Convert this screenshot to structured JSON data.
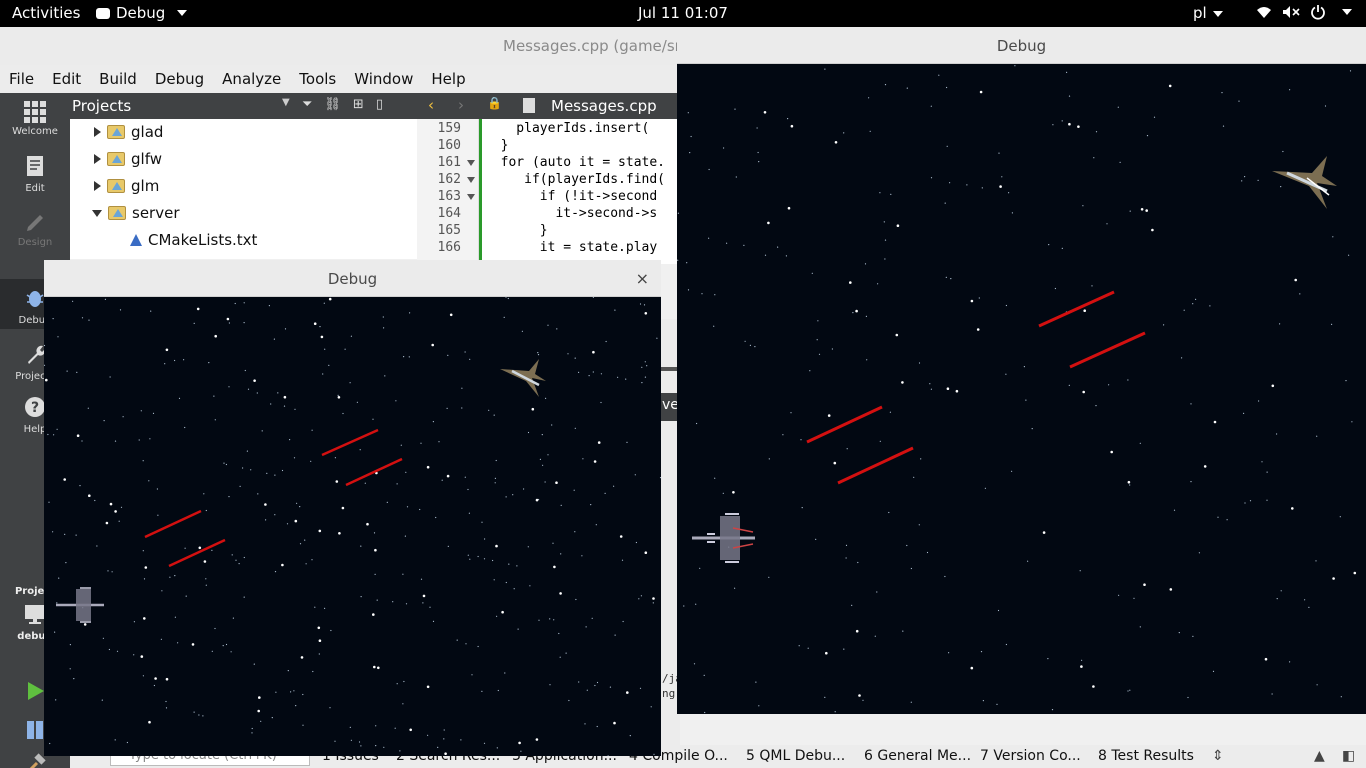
{
  "topbar": {
    "activities": "Activities",
    "app_name": "Debug",
    "clock": "Jul 11  01:07",
    "language": "pl",
    "icons": [
      "wifi-icon",
      "volume-muted-icon",
      "power-icon"
    ]
  },
  "qtcreator": {
    "title": "Messages.cpp (game/src ...",
    "menu": [
      "File",
      "Edit",
      "Build",
      "Debug",
      "Analyze",
      "Tools",
      "Window",
      "Help"
    ],
    "modes": [
      {
        "label": "Welcome",
        "icon": "grid-icon"
      },
      {
        "label": "Edit",
        "icon": "document-icon"
      },
      {
        "label": "Design",
        "icon": "pencil-icon"
      },
      {
        "label": "Debug",
        "icon": "bug-icon"
      },
      {
        "label": "Projects",
        "icon": "wrench-icon"
      },
      {
        "label": "Help",
        "icon": "help-icon"
      }
    ],
    "target": {
      "project": "Project",
      "config": "debug"
    },
    "projects_label": "Projects",
    "tree": [
      {
        "label": "glad",
        "type": "folder",
        "expanded": false
      },
      {
        "label": "glfw",
        "type": "folder",
        "expanded": false
      },
      {
        "label": "glm",
        "type": "folder",
        "expanded": false
      },
      {
        "label": "server",
        "type": "folder",
        "expanded": true
      },
      {
        "label": "CMakeLists.txt",
        "type": "cmake-file"
      }
    ],
    "editor_file": "Messages.cpp",
    "code": [
      {
        "ln": "159",
        "text": "    playerIds.insert(",
        "fold": false
      },
      {
        "ln": "160",
        "text": "  }",
        "fold": false
      },
      {
        "ln": "161",
        "text": "  for (auto it = state.",
        "fold": true
      },
      {
        "ln": "162",
        "text": "     if(playerIds.find(",
        "fold": true
      },
      {
        "ln": "163",
        "text": "       if (!it->second",
        "fold": true
      },
      {
        "ln": "164",
        "text": "         it->second->s",
        "fold": false
      },
      {
        "ln": "165",
        "text": "       }",
        "fold": false
      },
      {
        "ln": "166",
        "text": "       it = state.play",
        "fold": false
      }
    ],
    "side_fragment": "vex",
    "output_lines": [
      "/ja",
      "ng"
    ],
    "locator_placeholder": "Type to locate (Ctrl+K)",
    "output_panes": [
      "1  Issues",
      "2  Search Res...",
      "3  Application...",
      "4  Compile O...",
      "5  QML Debu...",
      "6  General Me...",
      "7  Version Co...",
      "8  Test Results"
    ]
  },
  "debug_window_small": {
    "title": "Debug",
    "close": "×"
  },
  "debug_window_large": {
    "title": "Debug"
  },
  "colors": {
    "space": "#020812",
    "laser": "#d31010",
    "qt_sidebar": "#404244"
  }
}
